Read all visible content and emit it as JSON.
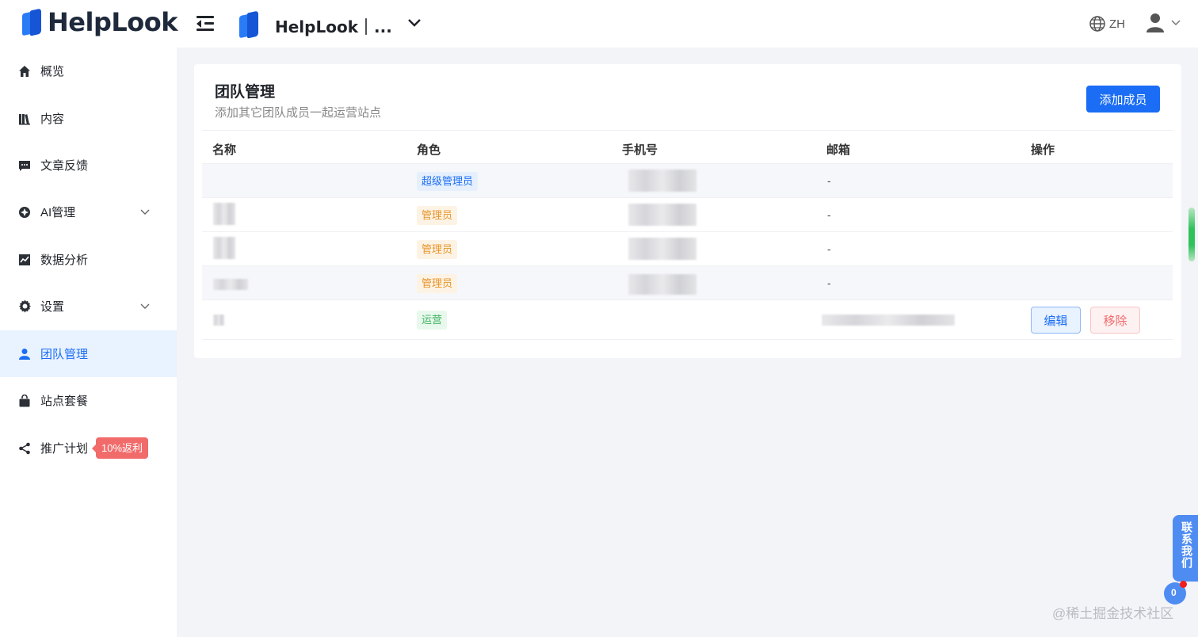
{
  "header": {
    "logo_text": "HelpLook",
    "site_name": "HelpLook｜...",
    "lang": "ZH"
  },
  "sidebar": {
    "items": [
      {
        "label": "概览",
        "icon": "home-icon"
      },
      {
        "label": "内容",
        "icon": "book-icon"
      },
      {
        "label": "文章反馈",
        "icon": "comment-icon"
      },
      {
        "label": "AI管理",
        "icon": "ai-icon"
      },
      {
        "label": "数据分析",
        "icon": "chart-icon"
      },
      {
        "label": "设置",
        "icon": "gear-icon"
      },
      {
        "label": "团队管理",
        "icon": "user-icon"
      },
      {
        "label": "站点套餐",
        "icon": "bag-icon"
      },
      {
        "label": "推广计划",
        "icon": "share-icon"
      }
    ],
    "promo_badge": "10%返利"
  },
  "team": {
    "title": "团队管理",
    "subtitle": "添加其它团队成员一起运营站点",
    "add_button": "添加成员",
    "columns": [
      "名称",
      "角色",
      "手机号",
      "邮箱",
      "操作"
    ],
    "rows": [
      {
        "role": "超级管理员",
        "email": "-"
      },
      {
        "role": "管理员",
        "email": "-"
      },
      {
        "role": "管理员",
        "email": "-"
      },
      {
        "role": "管理员",
        "email": "-"
      },
      {
        "role": "运营",
        "email": ""
      }
    ],
    "edit_button": "编辑",
    "remove_button": "移除"
  },
  "floating": {
    "contact": "联系我们",
    "chat_count": "0"
  },
  "watermark": "@稀土掘金技术社区",
  "colors": {
    "primary": "#1a6df4",
    "active_bg": "#e9f2ff",
    "badge": "#f26b6b",
    "page_bg": "#f3f4f8"
  }
}
